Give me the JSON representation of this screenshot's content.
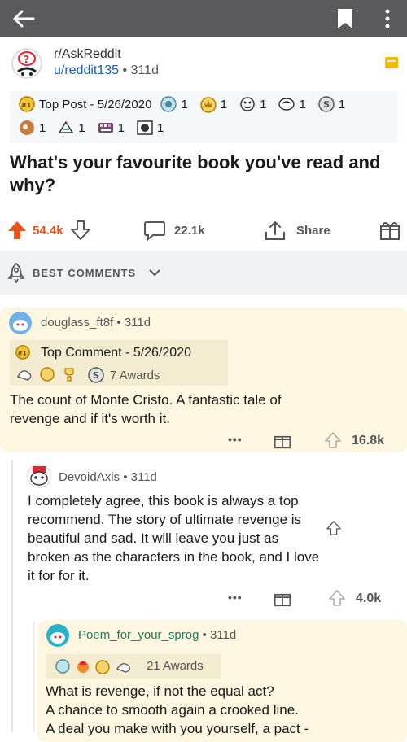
{
  "icons": [
    "back-arrow-icon",
    "bookmark-icon",
    "more-vertical-icon",
    "subreddit-icon",
    "post-flag-icon",
    "upvote-icon",
    "downvote-icon",
    "comment-icon",
    "share-icon",
    "gift-icon",
    "rocket-icon",
    "chevron-down-icon",
    "more-dots-icon"
  ],
  "colors": {
    "topbar": "#5a5a5c",
    "upvote": "#e8521b",
    "link": "#1a5fb4",
    "highlight": "#fdf7e1"
  },
  "post": {
    "subreddit": "r/AskReddit",
    "user": "u/reddit135",
    "age": "311d",
    "top_post": "Top Post - 5/26/2020",
    "award_counts": [
      "1",
      "1",
      "1",
      "1",
      "1",
      "1",
      "1",
      "1",
      "1"
    ],
    "title": "What's your favourite book you've read and why?",
    "upvotes": "54.4k",
    "comments": "22.1k",
    "share": "Share"
  },
  "sort": {
    "label": "BEST COMMENTS"
  },
  "comments": [
    {
      "user": "douglass_ft8f",
      "age": "311d",
      "top_comment": "Top Comment - 5/26/2020",
      "awards": "7 Awards",
      "text_lines": [
        "The count of Monte Cristo. A fantastic tale of",
        "revenge and if it's worth it."
      ],
      "dots": "•••",
      "votes": "16.8k"
    },
    {
      "user": "DevoidAxis",
      "age": "311d",
      "text_lines": [
        "I completely agree, this book is always a top",
        "recommend.  The story of ultimate revenge is",
        "beautiful and sad. It will leave you just as",
        "broken as the characters in the book, and I love",
        "it for for it."
      ],
      "dots": "•••",
      "votes": "4.0k"
    },
    {
      "user": "Poem_for_your_sprog",
      "age": "311d",
      "awards": "21 Awards",
      "text_lines": [
        "What is revenge, if not the equal act?",
        "A chance to smooth again a crooked line.",
        "A deal you make with you yourself, a pact -"
      ]
    }
  ]
}
